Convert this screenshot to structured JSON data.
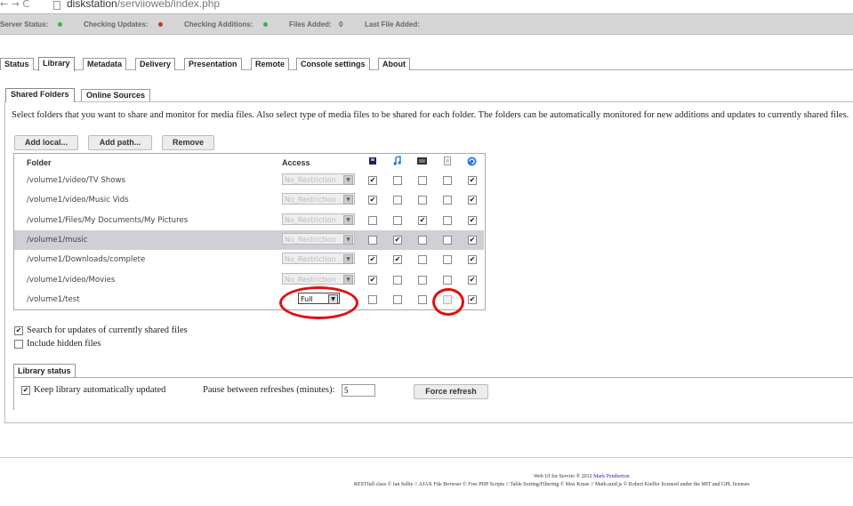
{
  "browser": {
    "nav_glyphs": "← → C",
    "url_host": "diskstation",
    "url_path": "/serviioweb/index.php"
  },
  "statusbar": {
    "server_status": "Server Status:",
    "checking_updates": "Checking Updates:",
    "checking_additions": "Checking Additions:",
    "files_added": "Files Added:",
    "files_added_value": "0",
    "last_file_added": "Last File Added:",
    "colors": {
      "green": "#3cb34a",
      "red": "#c0392b"
    }
  },
  "tabs": [
    "Status",
    "Library",
    "Metadata",
    "Delivery",
    "Presentation",
    "Remote",
    "Console settings",
    "About"
  ],
  "subtabs": [
    "Shared Folders",
    "Online Sources"
  ],
  "description": "Select folders that you want to share and monitor for media files. Also select type of media files to be shared for each folder. The folders can be automatically monitored for new additions and updates to currently shared files.",
  "buttons": {
    "add_local": "Add local...",
    "add_path": "Add path...",
    "remove": "Remove"
  },
  "table": {
    "col_folder": "Folder",
    "col_access": "Access",
    "icons": [
      "video-icon",
      "music-icon",
      "image-icon",
      "file-icon",
      "refresh-icon"
    ],
    "rows": [
      {
        "folder": "/volume1/video/TV Shows",
        "access": "No_Restriction",
        "checks": [
          true,
          false,
          false,
          false,
          true
        ]
      },
      {
        "folder": "/volume1/video/Music Vids",
        "access": "No_Restriction",
        "checks": [
          true,
          false,
          false,
          false,
          true
        ]
      },
      {
        "folder": "/volume1/Files/My Documents/My Pictures",
        "access": "No_Restriction",
        "checks": [
          false,
          false,
          true,
          false,
          true
        ]
      },
      {
        "folder": "/volume1/music",
        "access": "No_Restriction",
        "checks": [
          false,
          true,
          false,
          false,
          true
        ]
      },
      {
        "folder": "/volume1/Downloads/complete",
        "access": "No_Restriction",
        "checks": [
          true,
          true,
          false,
          false,
          true
        ]
      },
      {
        "folder": "/volume1/video/Movies",
        "access": "No_Restriction",
        "checks": [
          true,
          false,
          false,
          false,
          true
        ]
      },
      {
        "folder": "/volume1/test",
        "access": "Full",
        "checks": [
          false,
          false,
          false,
          false,
          true
        ]
      }
    ]
  },
  "options": {
    "search_updates": "Search for updates of currently shared files",
    "include_hidden": "Include hidden files"
  },
  "library_status": {
    "legend": "Library status",
    "keep_updated": "Keep library automatically updated",
    "pause_label": "Pause between refreshes (minutes):",
    "pause_value": "5",
    "force_refresh": "Force refresh"
  },
  "footer": {
    "line1_prefix": "Web UI for Serviio ® 2012",
    "line1_author": "Mark Pemberton",
    "line2": "RESTfull class © Ian Selby // AJAX File Browser © Free PHP Scripts // Table Sorting/Filtering © Max Kruse // Math.uuid.js © Robert Kieffer licensed under the MIT and GPL licenses"
  }
}
